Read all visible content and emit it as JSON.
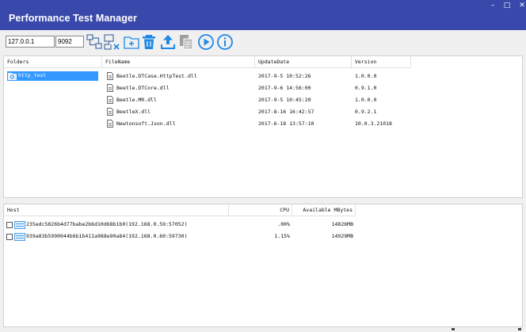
{
  "window": {
    "title": "Performance Test Manager",
    "controls": {
      "minimize": "–",
      "maximize": "□",
      "close": "✕"
    }
  },
  "toolbar": {
    "ip_value": "127.0.0.1",
    "port_value": "9092",
    "icons": [
      "connect-network-icon",
      "disconnect-network-icon",
      "add-folder-icon",
      "delete-icon",
      "upload-icon",
      "copy-document-icon",
      "run-icon",
      "info-icon"
    ]
  },
  "files_pane": {
    "headers": {
      "folders": "Folders",
      "filename": "FileName",
      "updatedate": "UpdateDate",
      "version": "Version"
    },
    "folders": [
      {
        "name": "http_test",
        "selected": true
      }
    ],
    "files": [
      {
        "name": "Beetle.DTCase.HttpTest.dll",
        "updated": "2017-9-5 10:52:26",
        "version": "1.0.0.0"
      },
      {
        "name": "Beetle.DTCore.dll",
        "updated": "2017-9-6 14:56:00",
        "version": "0.9.1.0"
      },
      {
        "name": "Beetle.MR.dll",
        "updated": "2017-9-5 10:45:20",
        "version": "1.0.0.0"
      },
      {
        "name": "BeetleX.dll",
        "updated": "2017-8-16 16:42:57",
        "version": "0.9.2.1"
      },
      {
        "name": "Newtonsoft.Json.dll",
        "updated": "2017-6-18 13:57:10",
        "version": "10.0.3.21018"
      }
    ]
  },
  "hosts_pane": {
    "headers": {
      "host": "Host",
      "cpu": "CPU",
      "memory": "Available MBytes"
    },
    "hosts": [
      {
        "host": "235edc5826b4d77babe2b6d10d68b1b0(192.168.0.59:57052)",
        "cpu": ".00%",
        "memory": "14826MB"
      },
      {
        "host": "939a83b5990044b6b1b411a988e90a84(192.168.0.60:59730)",
        "cpu": "1.15%",
        "memory": "14929MB"
      }
    ]
  },
  "colors": {
    "titlebar": "#3949ab",
    "selection": "#3399ff",
    "accent_blue": "#1e88e5"
  }
}
